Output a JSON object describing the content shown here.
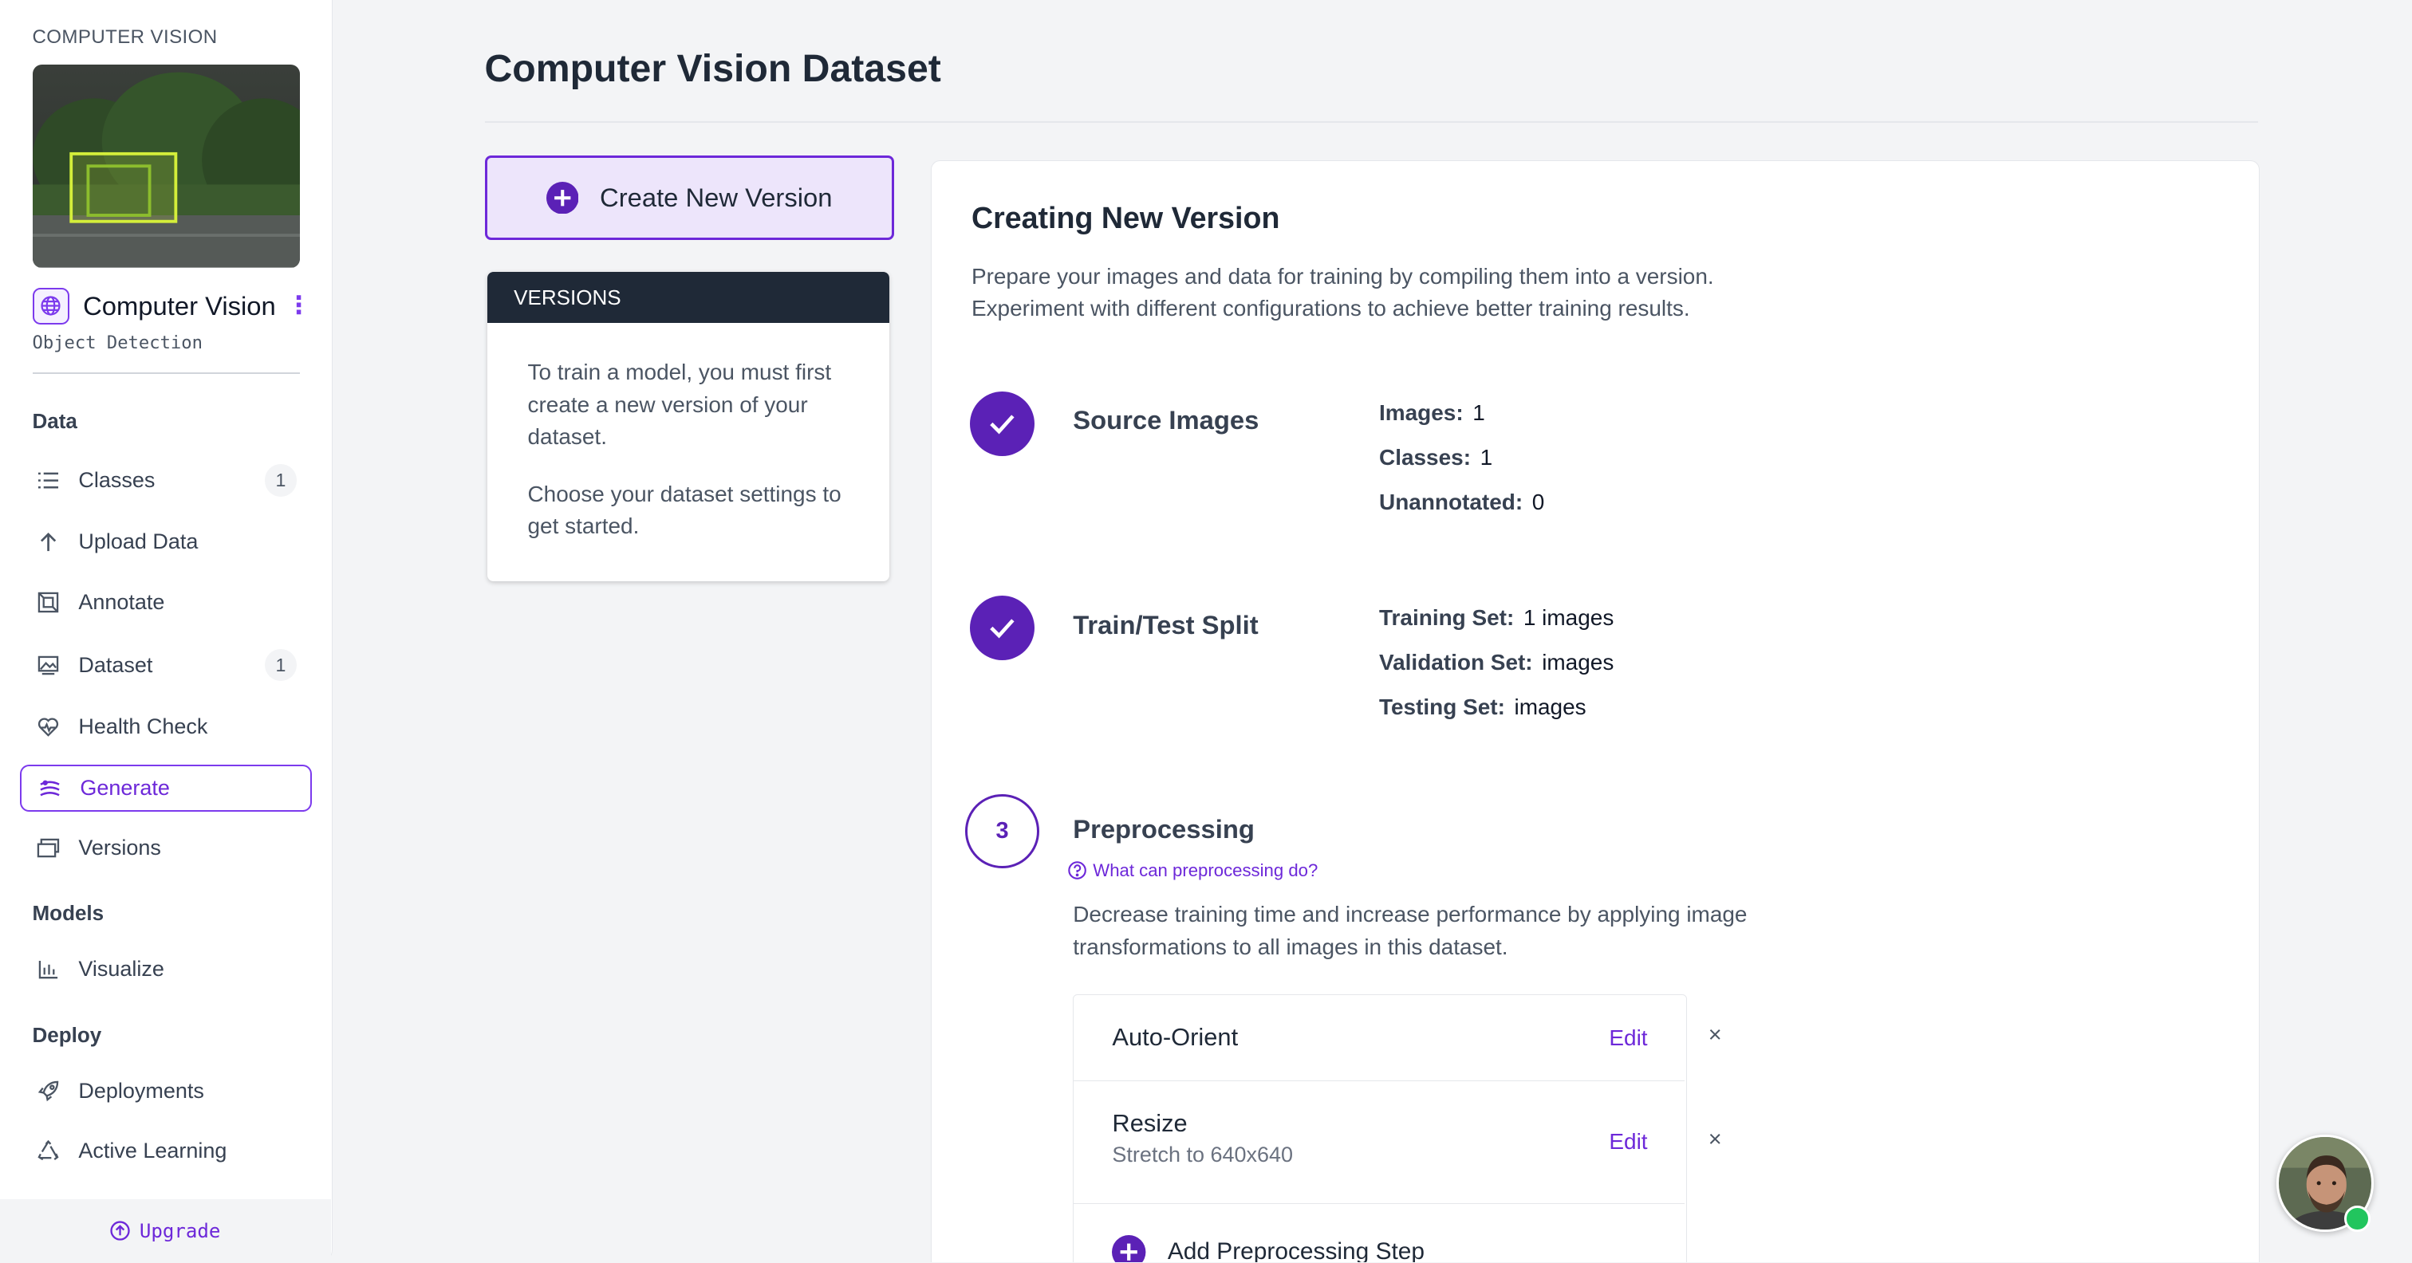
{
  "sidebar": {
    "project_label": "COMPUTER VISION",
    "project_name": "Computer Vision",
    "project_type": "Object Detection",
    "sections": {
      "data": "Data",
      "models": "Models",
      "deploy": "Deploy"
    },
    "items": [
      {
        "label": "Classes",
        "icon": "list-icon",
        "badge": "1"
      },
      {
        "label": "Upload Data",
        "icon": "upload-arrow-icon"
      },
      {
        "label": "Annotate",
        "icon": "annotate-icon"
      },
      {
        "label": "Dataset",
        "icon": "images-icon",
        "badge": "1"
      },
      {
        "label": "Health Check",
        "icon": "heart-pulse-icon"
      },
      {
        "label": "Generate",
        "icon": "generate-icon",
        "active": true
      },
      {
        "label": "Versions",
        "icon": "versions-icon"
      },
      {
        "label": "Visualize",
        "icon": "bar-chart-icon"
      },
      {
        "label": "Deployments",
        "icon": "rocket-icon"
      },
      {
        "label": "Active Learning",
        "icon": "recycle-icon"
      }
    ],
    "upgrade_label": "Upgrade"
  },
  "main": {
    "title": "Computer Vision Dataset",
    "create_button": "Create New Version",
    "versions_panel": {
      "header": "VERSIONS",
      "text1": "To train a model, you must first create a new version of your dataset.",
      "text2": "Choose your dataset settings to get started."
    },
    "creating": {
      "title": "Creating New Version",
      "desc_line1": "Prepare your images and data for training by compiling them into a version.",
      "desc_line2": "Experiment with different configurations to achieve better training results."
    },
    "steps": {
      "source": {
        "title": "Source Images",
        "images_label": "Images:",
        "images_value": "1",
        "classes_label": "Classes:",
        "classes_value": "1",
        "unannotated_label": "Unannotated:",
        "unannotated_value": "0"
      },
      "split": {
        "title": "Train/Test Split",
        "training_label": "Training Set:",
        "training_value": "1 images",
        "validation_label": "Validation Set:",
        "validation_value": "images",
        "testing_label": "Testing Set:",
        "testing_value": "images"
      },
      "preprocessing": {
        "number": "3",
        "title": "Preprocessing",
        "help": "What can preprocessing do?",
        "desc_line1": "Decrease training time and increase performance by applying image",
        "desc_line2": "transformations to all images in this dataset.",
        "items": [
          {
            "name": "Auto-Orient",
            "edit": "Edit",
            "remove": "×"
          },
          {
            "name": "Resize",
            "detail": "Stretch to 640x640",
            "edit": "Edit",
            "remove": "×"
          }
        ],
        "add_label": "Add Preprocessing Step"
      }
    }
  },
  "colors": {
    "accent": "#6d28d9",
    "step_fill": "#5b21b6",
    "dark_header": "#1f2937",
    "online": "#22c55e"
  }
}
